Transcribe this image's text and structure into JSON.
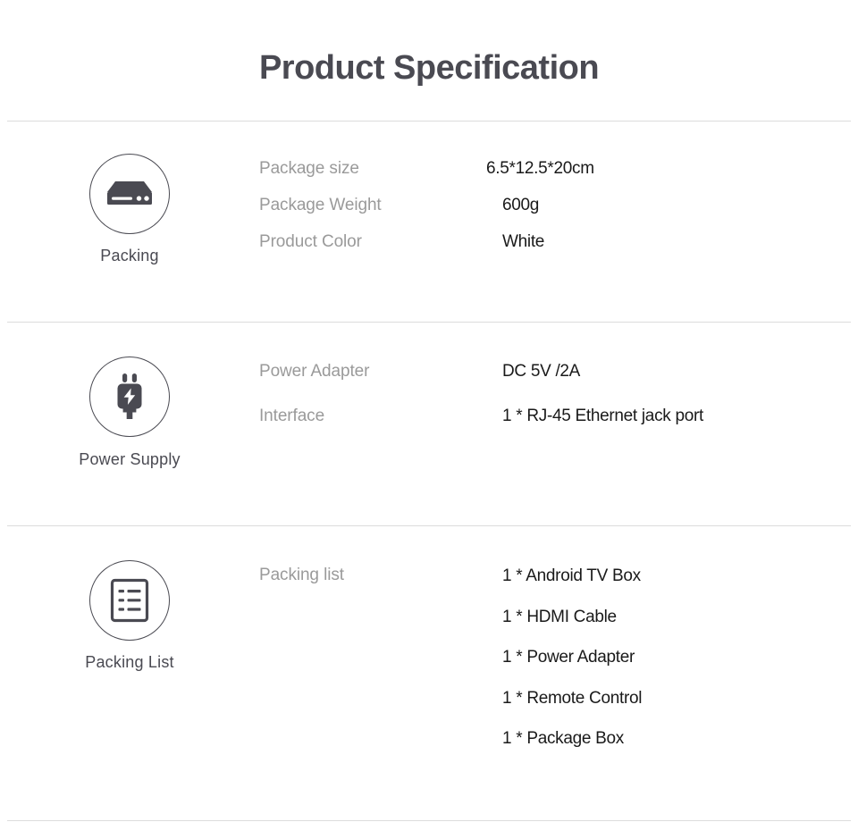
{
  "header": {
    "title": "Product Specification"
  },
  "sections": [
    {
      "icon_name": "set-top-box-icon",
      "caption": "Packing",
      "rows": [
        {
          "label": "Package size",
          "value": "6.5*12.5*20cm"
        },
        {
          "label": "Package Weight",
          "value": "600g"
        },
        {
          "label": "Product Color",
          "value": "White"
        }
      ]
    },
    {
      "icon_name": "power-plug-icon",
      "caption": "Power Supply",
      "rows": [
        {
          "label": "Power Adapter",
          "value": "DC 5V /2A"
        },
        {
          "label": "Interface",
          "value": "1 * RJ-45 Ethernet jack port"
        }
      ]
    },
    {
      "icon_name": "document-list-icon",
      "caption": "Packing List",
      "list_label": "Packing list",
      "items": [
        "1 * Android TV Box",
        "1 * HDMI Cable",
        "1 * Power Adapter",
        "1 * Remote Control",
        "1 * Package Box"
      ]
    }
  ],
  "colors": {
    "title": "#4a4a52",
    "label": "#9a9a9a",
    "value": "#1a1a1a",
    "icon": "#4a4a52",
    "divider": "#dcdcdc",
    "background": "#ffffff"
  }
}
